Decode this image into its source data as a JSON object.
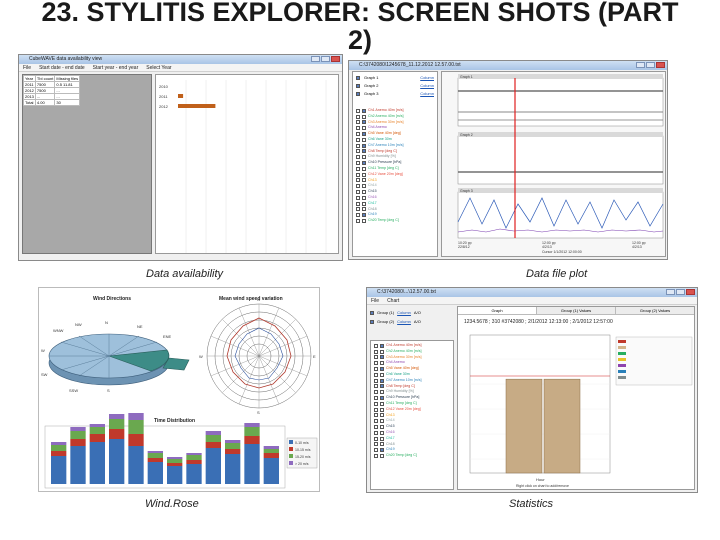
{
  "slide": {
    "title_line1": "23. STYLITIS EXPLORER: SCREEN SHOTS (PART",
    "title_line2": "2)"
  },
  "captions": {
    "availability": "Data availability",
    "file_plot": "Data file plot",
    "wind_rose": "Wind.Rose",
    "statistics": "Statistics"
  },
  "availability": {
    "window_title": "CubeWAVE data availability view",
    "menu": [
      "File",
      "Start date - end date",
      "Start year - end year",
      "Select Year"
    ],
    "table_headers": [
      "Year",
      "Tbl count",
      "Missing files"
    ],
    "table_rows": [
      [
        "2011",
        "7500",
        "0.5 11.81"
      ],
      [
        "2012",
        "7500",
        "..."
      ],
      [
        "2013",
        "...",
        "..."
      ],
      [
        "Total",
        "4.00",
        "30"
      ]
    ],
    "chart_labels": [
      "2010",
      "2011",
      "2012"
    ],
    "availability_fraction": [
      0.0,
      0.03,
      0.22
    ]
  },
  "file_plot": {
    "window_title": "C:\\3742080\\1245678_11.12.2012 12.57.00.txt",
    "graph_selectors": [
      "Graph 1",
      "Graph 2",
      "Graph 3"
    ],
    "graph_selector_values": [
      "Column",
      "Column",
      "Column"
    ],
    "graph_titles": [
      "Graph 1",
      "Graph 2",
      "Graph 3"
    ],
    "channels": [
      {
        "name": "Ch1 Anemo 40m [m/s]",
        "color": "#c0392b",
        "on": true
      },
      {
        "name": "Ch2 Anemo 40m [m/s]",
        "color": "#27ae60",
        "on": false
      },
      {
        "name": "Ch3 Anemo 30m [m/s]",
        "color": "#e67e22",
        "on": true
      },
      {
        "name": "Ch4 Anemo",
        "color": "#8e44ad",
        "on": false
      },
      {
        "name": "Ch5 Vane 40m [deg]",
        "color": "#d35400",
        "on": true
      },
      {
        "name": "Ch6 Vane 30m",
        "color": "#16a085",
        "on": false
      },
      {
        "name": "Ch7 Anemo 10m [m/s]",
        "color": "#2980b9",
        "on": true
      },
      {
        "name": "Ch8 Temp [deg C]",
        "color": "#c0392b",
        "on": true
      },
      {
        "name": "Ch9 Humidity [%]",
        "color": "#7f8c8d",
        "on": false
      },
      {
        "name": "Ch10 Pressure [hPa]",
        "color": "#2c3e50",
        "on": true
      },
      {
        "name": "Ch11 Temp [deg C]",
        "color": "#27ae60",
        "on": false
      },
      {
        "name": "Ch12 Vane 20m [deg]",
        "color": "#e74c3c",
        "on": false
      },
      {
        "name": "Ch13",
        "color": "#f39c12",
        "on": false
      },
      {
        "name": "Ch14",
        "color": "#95a5a6",
        "on": false
      },
      {
        "name": "Ch15",
        "color": "#34495e",
        "on": false
      },
      {
        "name": "Ch16",
        "color": "#9b59b6",
        "on": false
      },
      {
        "name": "Ch17",
        "color": "#1abc9c",
        "on": false
      },
      {
        "name": "Ch18",
        "color": "#7f8c8d",
        "on": false
      },
      {
        "name": "Ch19",
        "color": "#2980b9",
        "on": true
      },
      {
        "name": "Ch20 Temp [deg C]",
        "color": "#27ae60",
        "on": false
      }
    ],
    "x_ticks": [
      "10:20 pp\n22/8/12",
      "12:00 pp\n4/2/13",
      "12:00 pp\n4/2/13"
    ],
    "cursor": "Cursor 1/1/2012 12:00:00"
  },
  "wind_rose": {
    "pie_title": "Wind Directions",
    "polar_title": "Mean wind speed variation",
    "bar_title": "Time Distribution",
    "directions": [
      "N",
      "NNE",
      "NE",
      "ENE",
      "E",
      "ESE",
      "SE",
      "SSE",
      "S",
      "SSW",
      "SW",
      "WSW",
      "W",
      "WNW",
      "NW",
      "NNW"
    ],
    "bar_legend": [
      "0-10 m/s",
      "10-15 m/s",
      "15-20 m/s",
      "> 20 m/s"
    ],
    "bar_legend_colors": [
      "#3a6fb5",
      "#c0392b",
      "#6aa84f",
      "#8e6bbf"
    ],
    "bar_values": [
      [
        0.28,
        0.38,
        0.42,
        0.45,
        0.38,
        0.22,
        0.18,
        0.2,
        0.36,
        0.3,
        0.4,
        0.26
      ],
      [
        0.05,
        0.07,
        0.08,
        0.1,
        0.12,
        0.04,
        0.03,
        0.04,
        0.06,
        0.05,
        0.08,
        0.05
      ],
      [
        0.06,
        0.08,
        0.07,
        0.1,
        0.14,
        0.05,
        0.04,
        0.05,
        0.07,
        0.06,
        0.09,
        0.04
      ],
      [
        0.03,
        0.04,
        0.03,
        0.05,
        0.07,
        0.02,
        0.02,
        0.02,
        0.04,
        0.03,
        0.04,
        0.03
      ]
    ]
  },
  "statistics": {
    "window_title": "C:\\3742080\\...\\12.57.00.txt",
    "menu": [
      "File",
      "Chart"
    ],
    "tabs": [
      "Graph",
      "Group (1) Values",
      "Group (2) Values"
    ],
    "group_rows": [
      {
        "label": "Group (1)",
        "link": "Column",
        "extra": "A/O"
      },
      {
        "label": "Group (2)",
        "link": "Column",
        "extra": "A/O"
      }
    ],
    "info_line": "1234.5678 ; 310 #3742080 ; 2/1/2012 12:13:00 ; 2/1/2012 12:57:00",
    "bar_values": [
      0.68,
      0.68
    ],
    "x_label": "Hour",
    "footer": "Right click on chart to add/remove"
  }
}
